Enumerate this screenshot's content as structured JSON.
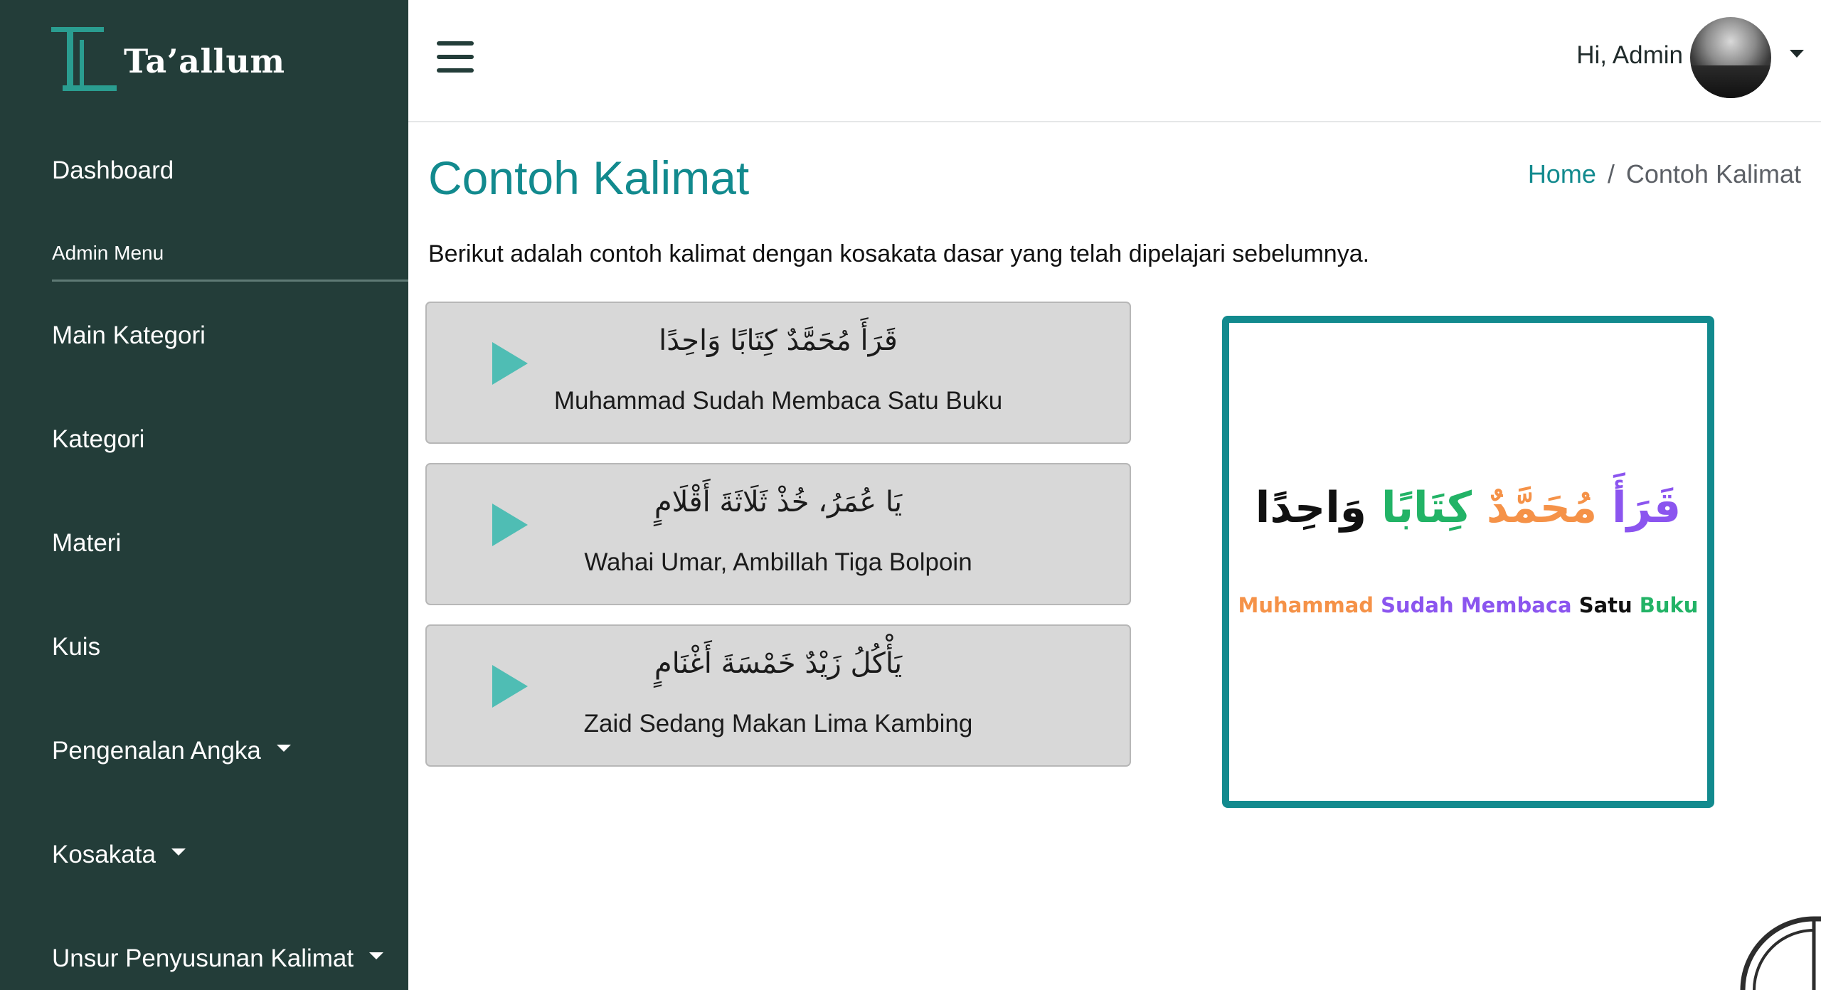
{
  "brand": {
    "name": "Ta’allum"
  },
  "sidebar": {
    "dashboard": "Dashboard",
    "section_heading": "Admin Menu",
    "items": [
      {
        "label": "Main Kategori",
        "has_caret": false
      },
      {
        "label": "Kategori",
        "has_caret": false
      },
      {
        "label": "Materi",
        "has_caret": false
      },
      {
        "label": "Kuis",
        "has_caret": false
      },
      {
        "label": "Pengenalan Angka",
        "has_caret": true
      },
      {
        "label": "Kosakata",
        "has_caret": true
      },
      {
        "label": "Unsur Penyusunan Kalimat",
        "has_caret": true
      }
    ]
  },
  "header": {
    "menu_icon": "hamburger-icon",
    "greeting": "Hi, Admin"
  },
  "page": {
    "title": "Contoh Kalimat",
    "breadcrumb": {
      "home": "Home",
      "separator": "/",
      "current": "Contoh Kalimat"
    },
    "intro": "Berikut adalah contoh kalimat dengan kosakata dasar yang telah dipelajari sebelumnya."
  },
  "sentences": [
    {
      "arabic": "قَرَأَ مُحَمَّدٌ كِتَابًا وَاحِدًا",
      "latin": "Muhammad Sudah Membaca Satu Buku"
    },
    {
      "arabic": "يَا عُمَرُ، خُذْ ثَلَاثَةَ أَقْلَامٍ",
      "latin": "Wahai Umar, Ambillah Tiga Bolpoin"
    },
    {
      "arabic": "يَأْكُلُ زَيْدٌ خَمْسَةَ أَغْنَامٍ",
      "latin": "Zaid Sedang Makan Lima Kambing"
    }
  ],
  "preview": {
    "arabic_words": [
      {
        "text": "قَرَأَ",
        "color": "#8b55ef"
      },
      {
        "text": "مُحَمَّدٌ",
        "color": "#f59248"
      },
      {
        "text": "كِتَابًا",
        "color": "#22b366"
      },
      {
        "text": "وَاحِدًا",
        "color": "#111111"
      }
    ],
    "latin_words": [
      {
        "text": "Muhammad",
        "color": "#f59248"
      },
      {
        "text": "Sudah Membaca",
        "color": "#8b55ef"
      },
      {
        "text": "Satu",
        "color": "#111111"
      },
      {
        "text": "Buku",
        "color": "#22b366"
      }
    ],
    "border_color": "#128a8e"
  },
  "colors": {
    "sidebar_bg": "#233d39",
    "accent": "#128a8e",
    "play": "#4fbdb4"
  }
}
